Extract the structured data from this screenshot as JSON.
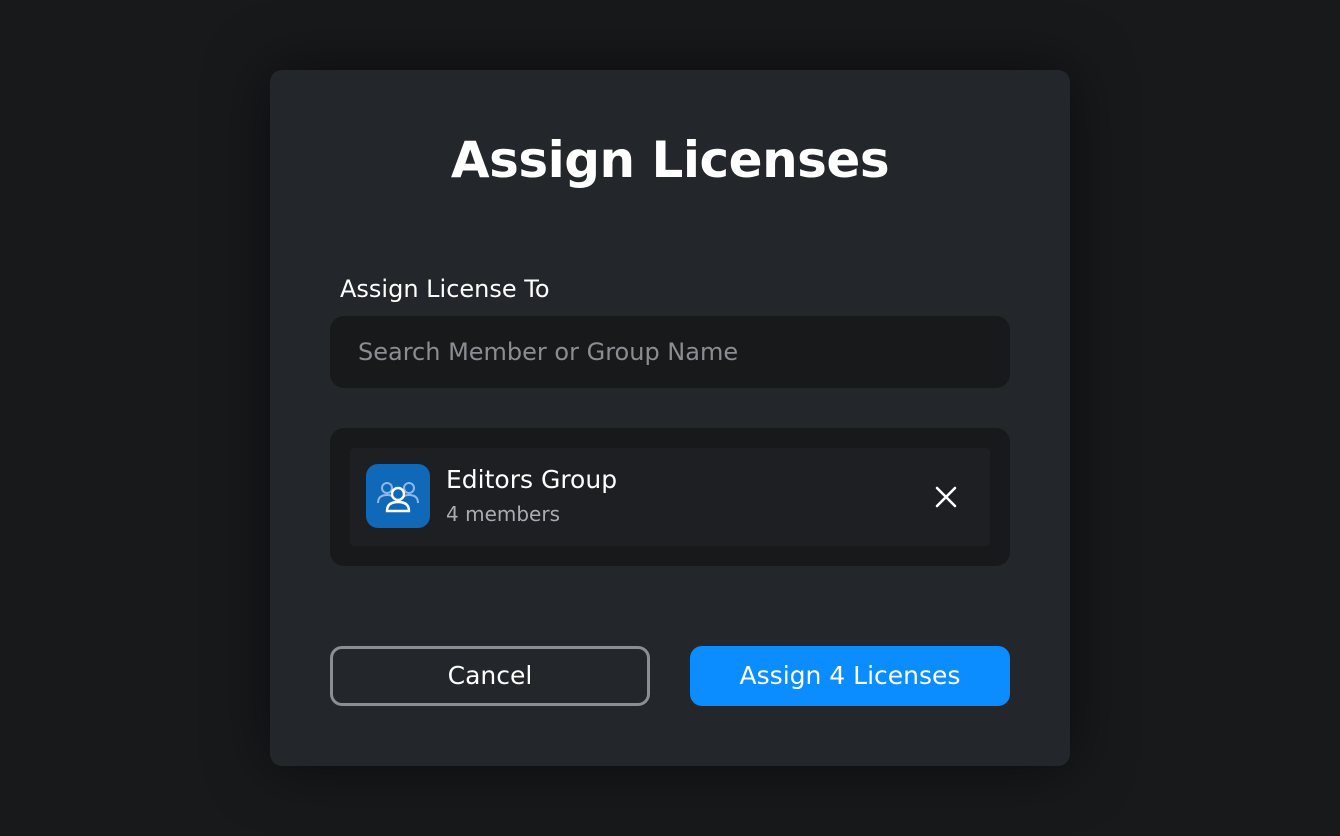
{
  "dialog": {
    "title": "Assign Licenses",
    "field_label": "Assign License To",
    "search": {
      "placeholder": "Search Member or Group Name",
      "value": ""
    },
    "selected": [
      {
        "name": "Editors Group",
        "count_text": "4 members",
        "icon": "group-icon",
        "icon_bg": "#0f68b8"
      }
    ],
    "buttons": {
      "cancel_label": "Cancel",
      "assign_label": "Assign 4 Licenses"
    }
  },
  "colors": {
    "backdrop": "#18191b",
    "dialog_bg": "#23262b",
    "primary": "#0b8cff",
    "muted_text": "#a8abb0"
  }
}
